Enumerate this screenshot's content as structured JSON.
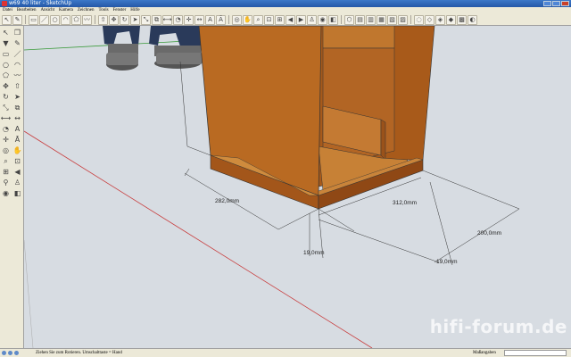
{
  "window": {
    "title": "w69 40 liter - SketchUp"
  },
  "menu": [
    "Datei",
    "Bearbeiten",
    "Ansicht",
    "Kamera",
    "Zeichnen",
    "Tools",
    "Fenster",
    "Hilfe"
  ],
  "toolbar_icons": [
    "select-icon",
    "eraser-icon",
    "rectangle-icon",
    "line-icon",
    "circle-icon",
    "arc-icon",
    "polygon-icon",
    "freehand-icon",
    "push-pull-icon",
    "move-icon",
    "rotate-icon",
    "follow-me-icon",
    "scale-icon",
    "offset-icon",
    "tape-icon",
    "protractor-icon",
    "axes-icon",
    "dimension-icon",
    "text-icon",
    "3d-text-icon",
    "orbit-icon",
    "pan-icon",
    "zoom-icon",
    "zoom-window-icon",
    "zoom-extents-icon",
    "previous-view-icon",
    "next-view-icon",
    "walk-icon",
    "look-around-icon",
    "section-icon",
    "iso-view-icon",
    "top-view-icon",
    "front-view-icon",
    "right-view-icon",
    "back-view-icon",
    "left-view-icon",
    "xray-icon",
    "wireframe-icon",
    "hidden-line-icon",
    "shaded-icon",
    "textured-icon",
    "monochrome-icon"
  ],
  "left_tools": [
    "select-icon",
    "component-icon",
    "paint-icon",
    "eraser-icon",
    "rectangle-icon",
    "line-icon",
    "circle-icon",
    "arc-icon",
    "polygon-icon",
    "freehand-icon",
    "move-icon",
    "push-pull-icon",
    "rotate-icon",
    "follow-me-icon",
    "scale-icon",
    "offset-icon",
    "tape-icon",
    "dimension-icon",
    "protractor-icon",
    "text-icon",
    "axes-icon",
    "3d-text-icon",
    "orbit-icon",
    "pan-icon",
    "zoom-icon",
    "zoom-window-icon",
    "zoom-extents-icon",
    "previous-icon",
    "position-camera-icon",
    "walk-icon",
    "look-around-icon",
    "section-icon"
  ],
  "dimensions": {
    "d1": "282,0mm",
    "d2": "312,0mm",
    "d3": "200,0mm",
    "d4": "19,0mm",
    "d5": "19,0mm"
  },
  "status": {
    "hint": "Ziehen Sie zum Rotieren. Umschalttaste = Hand",
    "measurements_label": "Maßangaben",
    "measurements_value": ""
  },
  "watermark": "hifi-forum.de",
  "colors": {
    "wood": "#b5651d",
    "wood_dark": "#8a4512",
    "background": "#d7dce2"
  }
}
